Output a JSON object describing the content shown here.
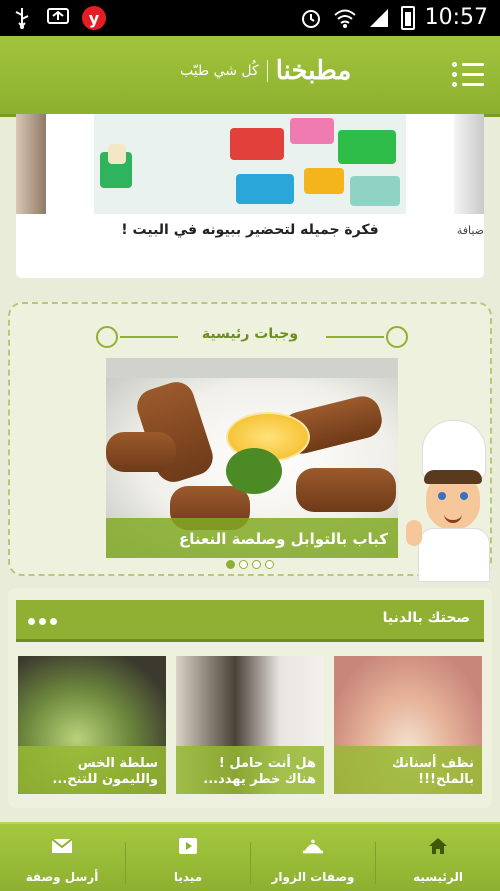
{
  "status_bar": {
    "time": "10:57",
    "left_icons": [
      "usb-icon",
      "sync-icon",
      "yandex-icon"
    ],
    "yandex_letter": "y",
    "right_icons": [
      "alarm-icon",
      "wifi-icon",
      "signal-icon",
      "battery-icon"
    ]
  },
  "app_bar": {
    "logo_text": "مطبخنا",
    "tagline": "كُل شي طيّب",
    "menu_icon": "list-menu-icon"
  },
  "top_carousel": {
    "center_caption": "فكرة جميله لتحضير ببيونه في البيت !",
    "right_partial_caption": "ضيافة"
  },
  "featured": {
    "section_title": "وجبات رئيسية",
    "caption": "كباب بالتوابل وصلصة النعناع",
    "slide_count": 4,
    "active_slide": 0
  },
  "health_section": {
    "title": "صحتك بالدنيا",
    "more_icon": "more-dots-icon",
    "tiles": [
      {
        "caption": "نظف أسنانك بالملح!!!"
      },
      {
        "caption": "هل أنت حامل ! هناك خطر يهدد..."
      },
      {
        "caption": "سلطة الخس والليمون للتنح..."
      }
    ]
  },
  "bottom_nav": {
    "items": [
      {
        "label": "الرئيسيه",
        "icon": "home-icon"
      },
      {
        "label": "وصفات الزوار",
        "icon": "cloche-icon"
      },
      {
        "label": "ميديا",
        "icon": "play-icon"
      },
      {
        "label": "أرسل وصفة",
        "icon": "mail-icon"
      }
    ]
  },
  "colors": {
    "brand_green": "#8fb032",
    "background": "#e9ecd9",
    "status_bar": "#000000"
  }
}
